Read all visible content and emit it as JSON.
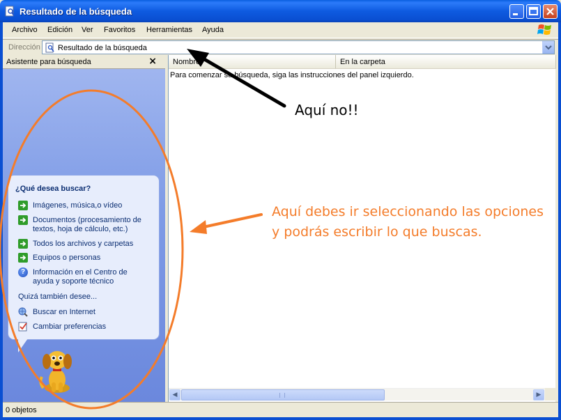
{
  "window": {
    "title": "Resultado de la búsqueda"
  },
  "menu": {
    "items": [
      "Archivo",
      "Edición",
      "Ver",
      "Favoritos",
      "Herramientas",
      "Ayuda"
    ]
  },
  "address": {
    "label": "Dirección",
    "value": "Resultado de la búsqueda"
  },
  "search_pane": {
    "title": "Asistente para búsqueda",
    "close": "×",
    "question": "¿Qué desea buscar?",
    "options": [
      "Imágenes, música,o vídeo",
      "Documentos (procesamiento de textos, hoja de cálculo, etc.)",
      "Todos los archivos y carpetas",
      "Equipos o personas",
      "Información en el Centro de ayuda y soporte técnico"
    ],
    "also_label": "Quizá también desee...",
    "also_options": [
      "Buscar en Internet",
      "Cambiar preferencias"
    ]
  },
  "results": {
    "columns": [
      "Nombre",
      "En la carpeta"
    ],
    "message": "Para comenzar su búsqueda, siga las instrucciones del panel izquierdo."
  },
  "status": {
    "text": "0 objetos"
  },
  "annotations": {
    "black_note": "Aquí no!!",
    "orange_note": "Aquí debes ir seleccionando las opciones y podrás escribir lo que buscas.",
    "black_color": "#000000",
    "orange_color": "#F47C2A"
  },
  "icons": {
    "title": "search-window-icon",
    "address": "search-page-icon",
    "option_arrow": "green-arrow-icon",
    "help": "help-icon",
    "internet": "internet-search-icon",
    "preferences": "preferences-icon",
    "assistant": "rover-dog-icon"
  }
}
